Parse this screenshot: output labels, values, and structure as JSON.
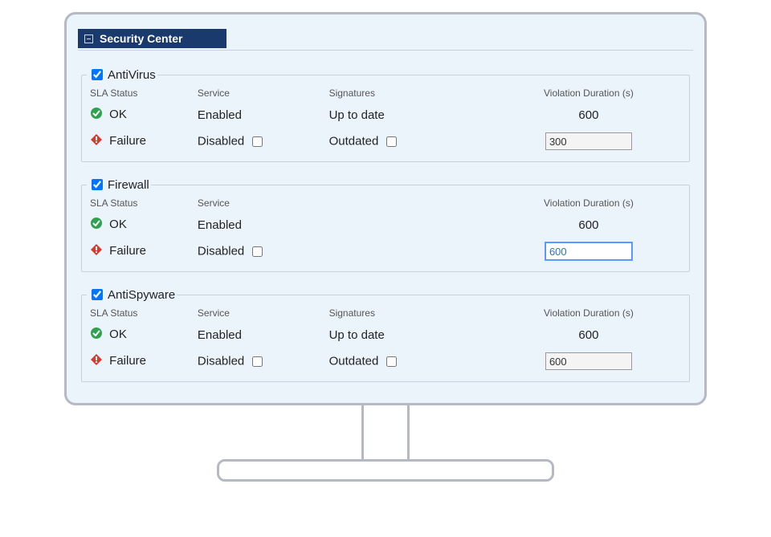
{
  "panel": {
    "title": "Security Center"
  },
  "columns": {
    "sla": "SLA Status",
    "service": "Service",
    "signatures": "Signatures",
    "duration": "Violation Duration (s)"
  },
  "status": {
    "ok": "OK",
    "failure": "Failure"
  },
  "service": {
    "enabled": "Enabled",
    "disabled": "Disabled"
  },
  "signatures": {
    "up_to_date": "Up to date",
    "outdated": "Outdated"
  },
  "sections": {
    "antivirus": {
      "title": "AntiVirus",
      "checked": true,
      "has_signatures": true,
      "ok_duration": "600",
      "fail_duration": "300",
      "fail_focused": false
    },
    "firewall": {
      "title": "Firewall",
      "checked": true,
      "has_signatures": false,
      "ok_duration": "600",
      "fail_duration": "600",
      "fail_focused": true
    },
    "antispyware": {
      "title": "AntiSpyware",
      "checked": true,
      "has_signatures": true,
      "ok_duration": "600",
      "fail_duration": "600",
      "fail_focused": false
    }
  }
}
